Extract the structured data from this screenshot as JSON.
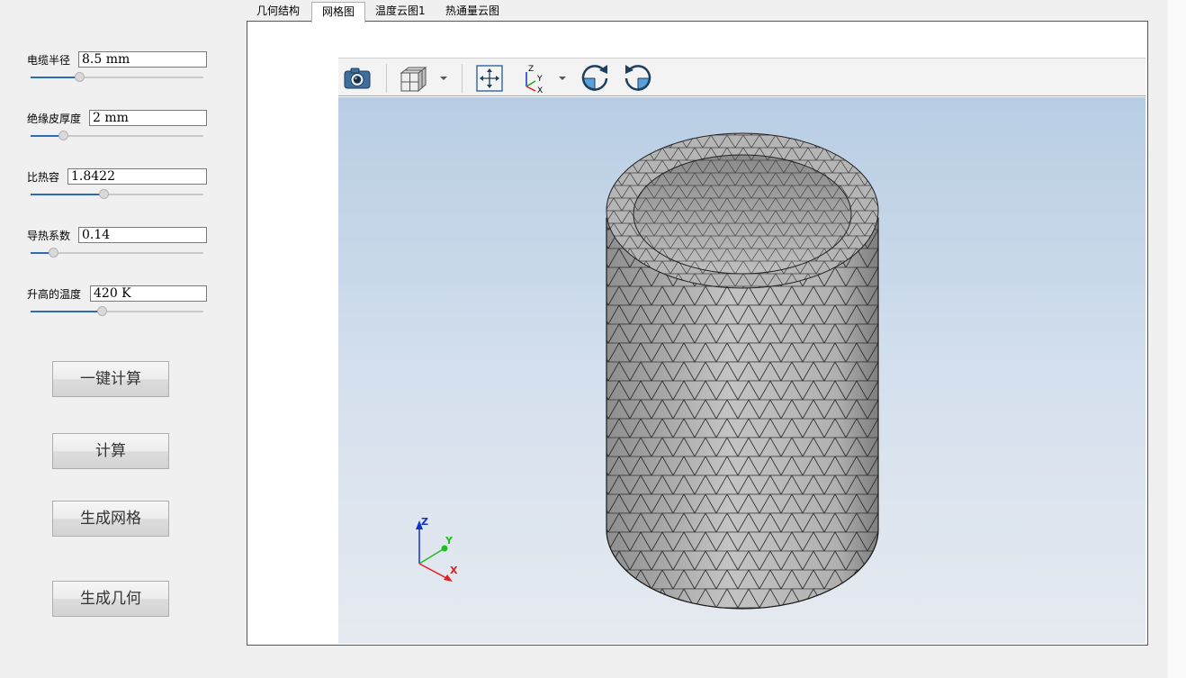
{
  "params": [
    {
      "label": "电缆半径",
      "value": "8.5 mm",
      "slider": 0.28
    },
    {
      "label": "绝缘皮厚度",
      "value": "2 mm",
      "slider": 0.19
    },
    {
      "label": "比热容",
      "value": "1.8422",
      "slider": 0.42
    },
    {
      "label": "导热系数",
      "value": "0.14",
      "slider": 0.13
    },
    {
      "label": "升高的温度",
      "value": "420 K",
      "slider": 0.41
    }
  ],
  "buttons": {
    "one_click_compute": "一键计算",
    "compute": "计算",
    "generate_mesh": "生成网格",
    "generate_geometry": "生成几何"
  },
  "tabs": [
    "几何结构",
    "网格图",
    "温度云图1",
    "热通量云图"
  ],
  "active_tab": 1,
  "toolbar_icons": [
    "camera-icon",
    "view-cube-icon",
    "fit-all-icon",
    "axes-icon",
    "rotate-cw-icon",
    "rotate-ccw-icon"
  ],
  "triad": {
    "x": "X",
    "y": "Y",
    "z": "Z"
  },
  "toolbar_axes": {
    "z": "Z",
    "y": "Y",
    "x": "X"
  },
  "colors": {
    "accent": "#2b6cb5",
    "mesh_fill": "#a8a8a8",
    "axis_x": "#e02020",
    "axis_y": "#20c020",
    "axis_z": "#1030d0"
  }
}
